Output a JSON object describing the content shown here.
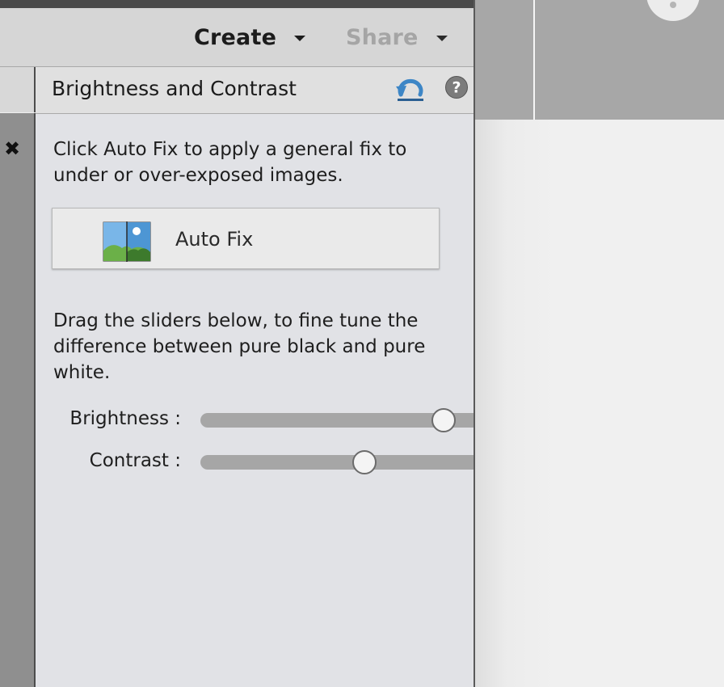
{
  "header": {
    "create_label": "Create",
    "share_label": "Share"
  },
  "panel": {
    "title": "Brightness and Contrast",
    "description_auto": "Click Auto Fix to apply a general fix to under or over-exposed images.",
    "auto_fix_label": "Auto Fix",
    "description_sliders": "Drag the sliders below, to fine tune the difference between pure black and pure white.",
    "sliders": [
      {
        "label": "Brightness :",
        "value_fraction": 0.89
      },
      {
        "label": "Contrast :",
        "value_fraction": 0.6
      }
    ]
  },
  "icons": {
    "close": "close-icon",
    "reset": "reset-icon",
    "help": "help-icon",
    "auto_fix": "auto-fix-icon"
  },
  "colors": {
    "reset_icon": "#3d86c6",
    "help_icon": "#7c7c7c"
  }
}
